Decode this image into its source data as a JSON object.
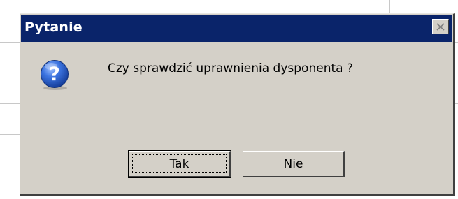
{
  "dialog": {
    "title": "Pytanie",
    "message": "Czy sprawdzić uprawnienia dysponenta ?",
    "icon": "question-icon",
    "close_icon": "close-icon",
    "buttons": {
      "yes_label": "Tak",
      "no_label": "Nie"
    }
  },
  "colors": {
    "titlebar": "#0a246a",
    "dialog_face": "#d4d0c8",
    "icon_blue": "#1f56c6"
  }
}
